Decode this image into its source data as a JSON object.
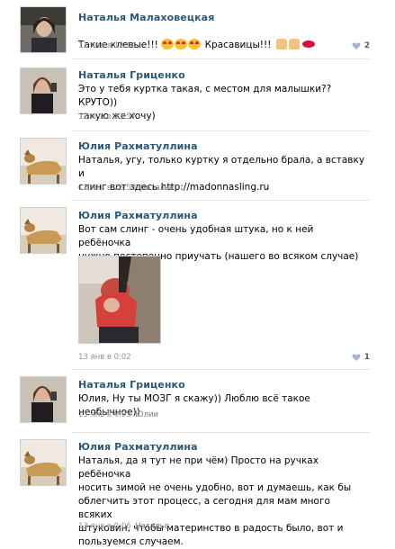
{
  "comments": [
    {
      "author": "Наталья Малаховецкая",
      "text": "Такие клевые!!! ",
      "text_tail": " Красавицы!!! ",
      "time": "11 янв в 12:14",
      "reply_to": "",
      "likes": "2",
      "avatar": "woman-portrait"
    },
    {
      "author": "Наталья Гриценко",
      "text": "Это у тебя куртка такая, с местом для малышки?? КРУТО))\nтакую же хочу)",
      "time": "12 янв в 23:57",
      "reply_to": "",
      "likes": "",
      "avatar": "woman-with-phone"
    },
    {
      "author": "Юлия Рахматуллина",
      "text": "Наталья, угу, только куртку я отдельно брала, а вставку и\nслинг вот здесь http://madonnasling.ru",
      "time": "12 янв в 23:58",
      "reply_to": "Наталье",
      "likes": "",
      "avatar": "dog-on-chair"
    },
    {
      "author": "Юлия Рахматуллина",
      "text": "Вот сам слинг - очень удобная штука, но к ней ребёночка\nнужно постепенно приучать (нашего во всяком случае)",
      "time": "13 янв в 0:02",
      "reply_to": "",
      "likes": "1",
      "avatar": "dog-on-chair",
      "photo": "baby-in-sling"
    },
    {
      "author": "Наталья Гриценко",
      "text": "Юлия, Ну ты МОЗГ я скажу)) Люблю всё такое необычное))",
      "time": "13 янв в 0:03",
      "reply_to": "Юлии",
      "likes": "",
      "avatar": "woman-with-phone"
    },
    {
      "author": "Юлия Рахматуллина",
      "text": "Наталья, да я тут не при чём) Просто на ручках ребёночка\nносить зимой не очень удобно, вот и думаешь, как бы\nоблегчить этот процесс, а сегодня для мам много всяких\nштуковин, чтобы материнство в радость было, вот и\nпользуемся случаем.",
      "time": "13 янв в 0:06",
      "reply_to": "Наталье",
      "likes": "",
      "avatar": "dog-on-chair"
    }
  ],
  "colors": {
    "name": "#2b587a",
    "meta": "#8c96a3",
    "divider": "#dfe3e8",
    "heart": "#a6b4c6"
  }
}
